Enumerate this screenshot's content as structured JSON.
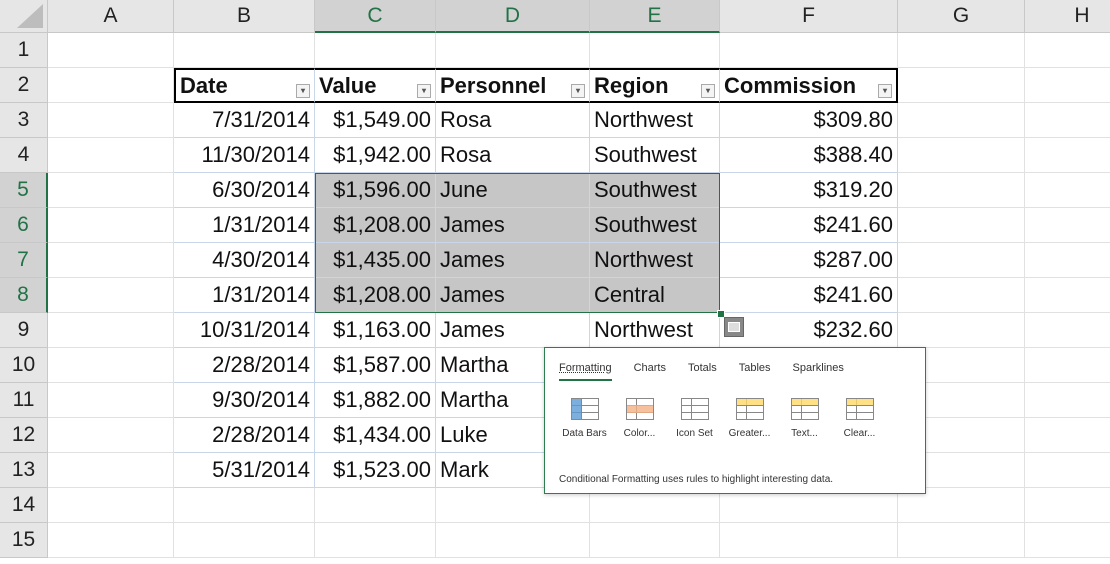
{
  "columns": [
    "A",
    "B",
    "C",
    "D",
    "E",
    "F",
    "G",
    "H"
  ],
  "rows": [
    "1",
    "2",
    "3",
    "4",
    "5",
    "6",
    "7",
    "8",
    "9",
    "10",
    "11",
    "12",
    "13",
    "14",
    "15"
  ],
  "table": {
    "headers": [
      "Date",
      "Value",
      "Personnel",
      "Region",
      "Commission"
    ],
    "body": [
      [
        "7/31/2014",
        "$1,549.00",
        "Rosa",
        "Northwest",
        "$309.80"
      ],
      [
        "11/30/2014",
        "$1,942.00",
        "Rosa",
        "Southwest",
        "$388.40"
      ],
      [
        "6/30/2014",
        "$1,596.00",
        "June",
        "Southwest",
        "$319.20"
      ],
      [
        "1/31/2014",
        "$1,208.00",
        "James",
        "Southwest",
        "$241.60"
      ],
      [
        "4/30/2014",
        "$1,435.00",
        "James",
        "Northwest",
        "$287.00"
      ],
      [
        "1/31/2014",
        "$1,208.00",
        "James",
        "Central",
        "$241.60"
      ],
      [
        "10/31/2014",
        "$1,163.00",
        "James",
        "Northwest",
        "$232.60"
      ],
      [
        "2/28/2014",
        "$1,587.00",
        "Martha",
        "",
        ""
      ],
      [
        "9/30/2014",
        "$1,882.00",
        "Martha",
        "",
        ""
      ],
      [
        "2/28/2014",
        "$1,434.00",
        "Luke",
        "",
        ""
      ],
      [
        "5/31/2014",
        "$1,523.00",
        "Mark",
        "",
        ""
      ]
    ]
  },
  "quick_analysis": {
    "tabs": [
      "Formatting",
      "Charts",
      "Totals",
      "Tables",
      "Sparklines"
    ],
    "options": [
      "Data Bars",
      "Color...",
      "Icon Set",
      "Greater...",
      "Text...",
      "Clear..."
    ],
    "description": "Conditional Formatting uses rules to highlight interesting data."
  },
  "colors": {
    "accent": "#217346",
    "selection": "#c6c6c6"
  }
}
